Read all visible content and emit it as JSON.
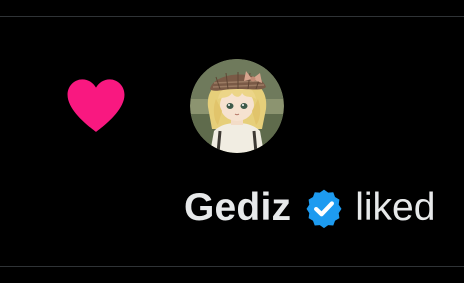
{
  "notification": {
    "user_name": "Gediz",
    "verified_badge_icon": "verified-badge-icon",
    "action_text": "liked",
    "notification_icon": "heart-icon"
  },
  "colors": {
    "background": "#000000",
    "heart": "#f91880",
    "verified": "#1d9bf0",
    "text": "#e7e9ea",
    "divider": "#2f3336"
  }
}
